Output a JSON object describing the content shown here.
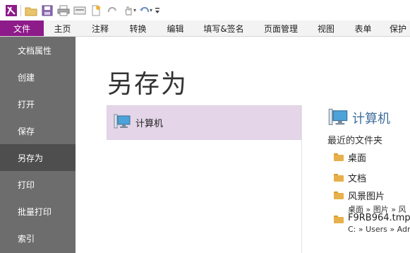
{
  "quick_access": {
    "icons": [
      "app-logo-icon",
      "open-folder-icon",
      "save-icon",
      "print-icon",
      "scan-icon",
      "new-icon",
      "redo-icon",
      "hand-tool-icon",
      "undo-icon",
      "customize-icon"
    ],
    "colors": {
      "logo": "#8e1b8a"
    }
  },
  "tabs": [
    {
      "label": "文件",
      "active": true
    },
    {
      "label": "主页"
    },
    {
      "label": "注释"
    },
    {
      "label": "转换"
    },
    {
      "label": "编辑"
    },
    {
      "label": "填写&签名"
    },
    {
      "label": "页面管理"
    },
    {
      "label": "视图"
    },
    {
      "label": "表单"
    },
    {
      "label": "保护"
    }
  ],
  "sidebar": {
    "items": [
      {
        "label": "文档属性"
      },
      {
        "label": "创建"
      },
      {
        "label": "打开"
      },
      {
        "label": "保存"
      },
      {
        "label": "另存为",
        "active": true
      },
      {
        "label": "打印"
      },
      {
        "label": "批量打印"
      },
      {
        "label": "索引"
      }
    ]
  },
  "main": {
    "title": "另存为",
    "places": [
      {
        "label": "计算机",
        "icon": "computer-icon",
        "selected": true
      }
    ],
    "detail": {
      "heading": "计算机",
      "recent_label": "最近的文件夹",
      "folders": [
        {
          "name": "桌面"
        },
        {
          "name": "文档"
        },
        {
          "name": "风景图片",
          "path": "桌面 » 图片 » 风"
        },
        {
          "name": "F9RB964.tmp",
          "path": "C: » Users » Adr"
        }
      ]
    }
  },
  "colors": {
    "file_tab": "#8e1b8a",
    "sidebar": "#6d6d6d",
    "sidebar_active": "#4e4e4e",
    "place_selected": "#e4d5e8",
    "heading_blue": "#3f6e9c",
    "folder": "#e8b04a"
  }
}
